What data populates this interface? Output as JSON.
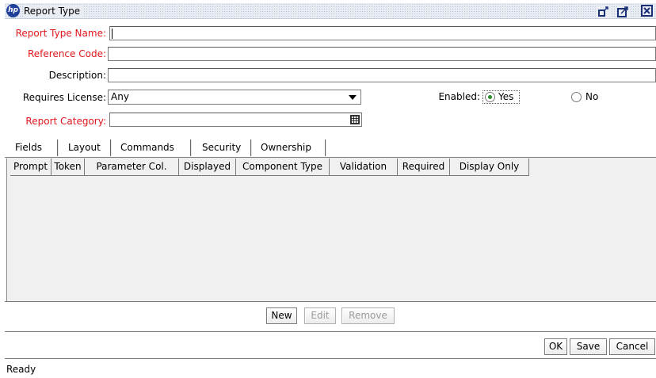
{
  "window": {
    "title": "Report Type",
    "logo_text": "hp",
    "controls": [
      "restore-icon",
      "maximize-icon",
      "close-icon"
    ]
  },
  "form": {
    "report_type_name": {
      "label": "Report Type Name:",
      "value": ""
    },
    "reference_code": {
      "label": "Reference Code:",
      "value": ""
    },
    "description": {
      "label": "Description:",
      "value": ""
    },
    "requires_license": {
      "label": "Requires License:",
      "value": "Any"
    },
    "enabled": {
      "label": "Enabled:",
      "options": [
        {
          "label": "Yes",
          "selected": true
        },
        {
          "label": "No",
          "selected": false
        }
      ]
    },
    "report_category": {
      "label": "Report Category:",
      "value": ""
    }
  },
  "colors": {
    "required_label": "#e0161d",
    "radio_selected": "#2c8a2c"
  },
  "tabs": [
    {
      "label": "Fields",
      "active": true
    },
    {
      "label": "Layout",
      "active": false
    },
    {
      "label": "Commands",
      "active": false
    },
    {
      "label": "Security",
      "active": false
    },
    {
      "label": "Ownership",
      "active": false
    }
  ],
  "table": {
    "columns": [
      "Prompt",
      "Token",
      "Parameter Col.",
      "Displayed",
      "Component Type",
      "Validation",
      "Required",
      "Display Only"
    ],
    "rows": []
  },
  "grid_buttons": [
    {
      "label": "New",
      "enabled": true
    },
    {
      "label": "Edit",
      "enabled": false
    },
    {
      "label": "Remove",
      "enabled": false
    }
  ],
  "dialog_buttons": [
    "OK",
    "Save",
    "Cancel"
  ],
  "status": "Ready"
}
